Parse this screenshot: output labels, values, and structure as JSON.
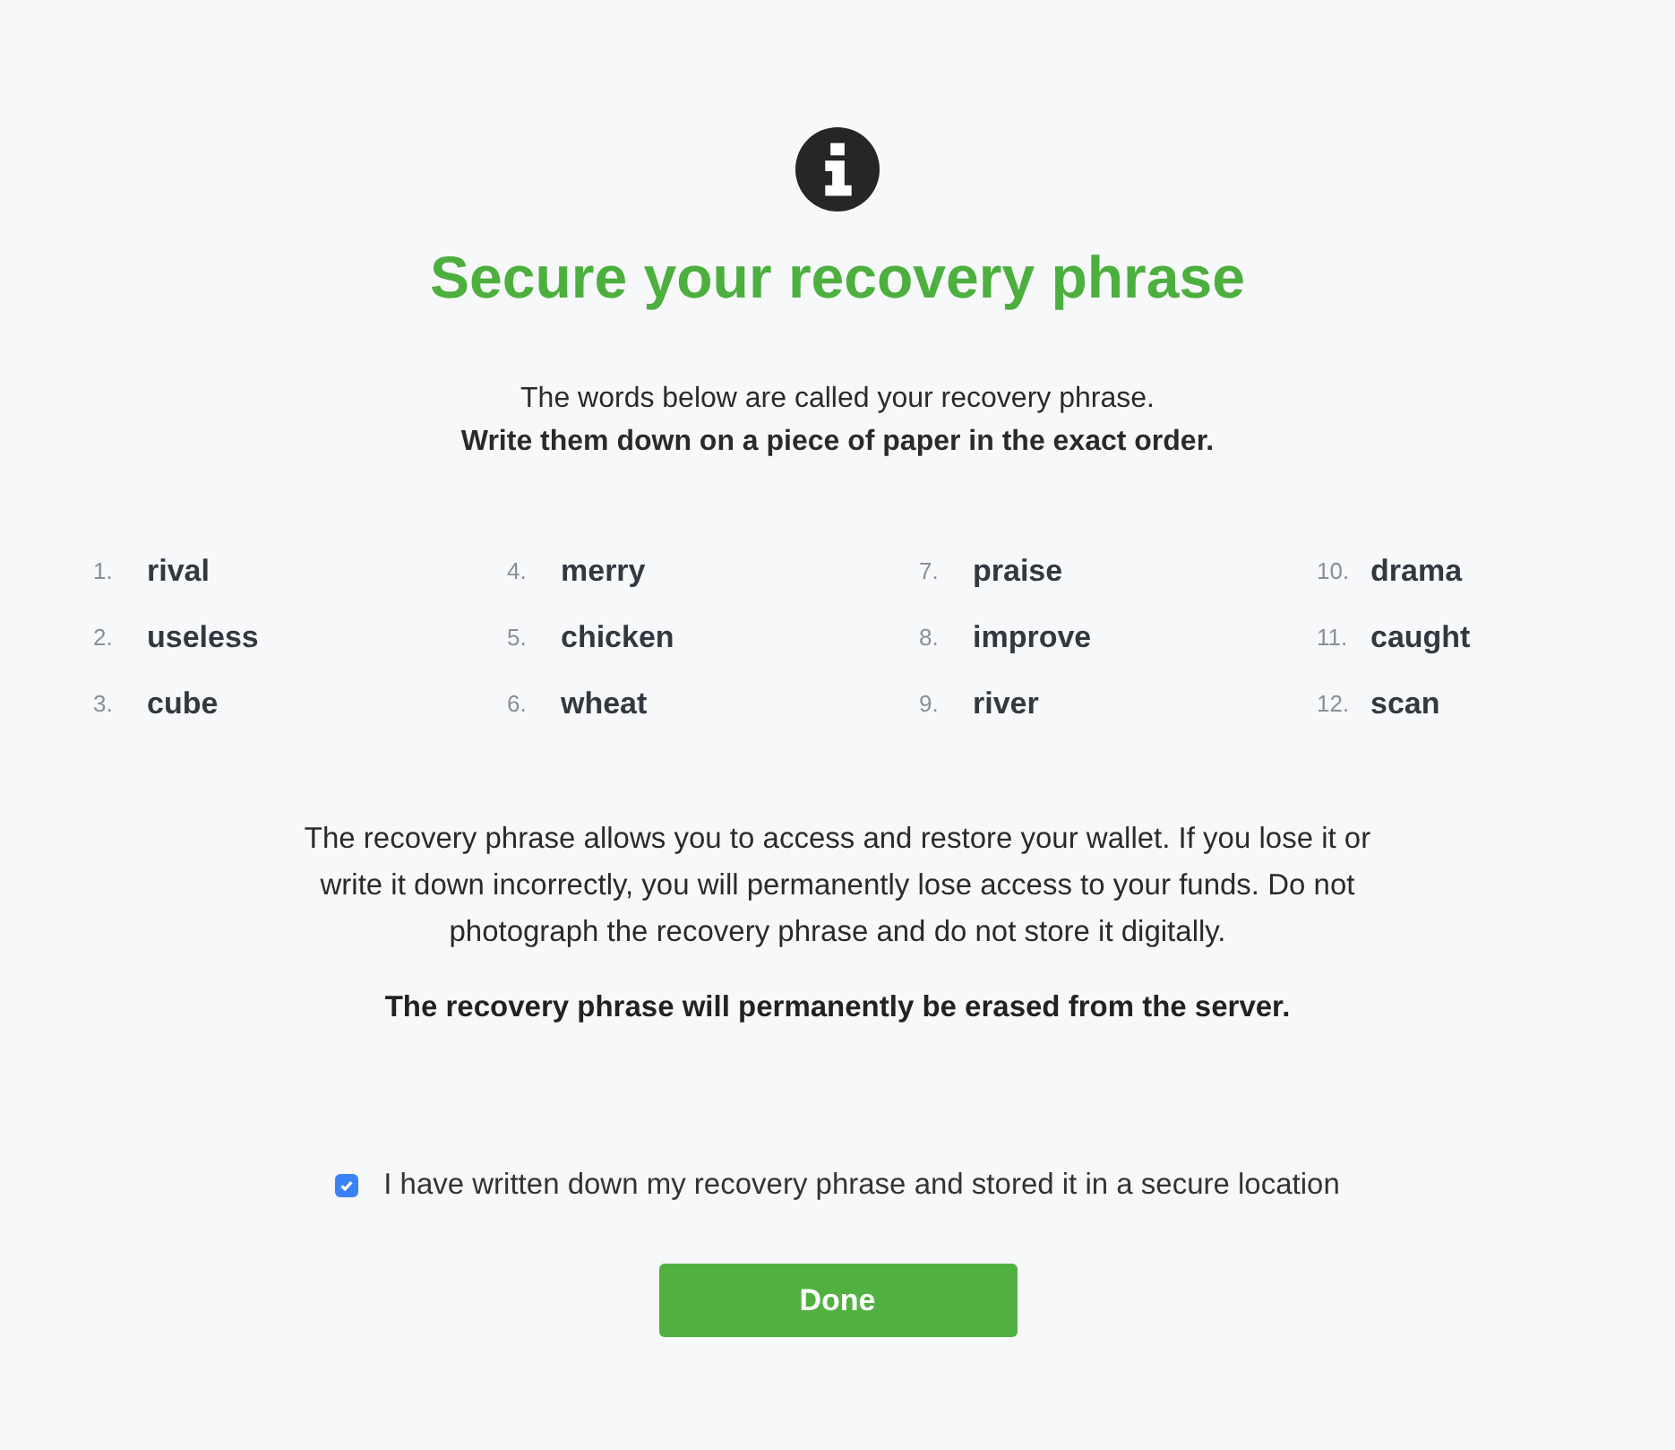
{
  "title": "Secure your recovery phrase",
  "intro": [
    {
      "kind": "plain",
      "text": "The words below are called your recovery phrase."
    },
    {
      "kind": "bold",
      "text": "Write them down on a piece of paper in the exact order."
    }
  ],
  "words": [
    {
      "number": "1.",
      "word": "rival"
    },
    {
      "number": "2.",
      "word": "useless"
    },
    {
      "number": "3.",
      "word": "cube"
    },
    {
      "number": "4.",
      "word": "merry"
    },
    {
      "number": "5.",
      "word": "chicken"
    },
    {
      "number": "6.",
      "word": "wheat"
    },
    {
      "number": "7.",
      "word": "praise"
    },
    {
      "number": "8.",
      "word": "improve"
    },
    {
      "number": "9.",
      "word": "river"
    },
    {
      "number": "10.",
      "word": "drama"
    },
    {
      "number": "11.",
      "word": "caught"
    },
    {
      "number": "12.",
      "word": "scan"
    }
  ],
  "warning": "The recovery phrase allows you to access and restore your wallet. If you lose it or write it down incorrectly, you will permanently lose access to your funds. Do not photograph the recovery phrase and do not store it digitally.",
  "notice": "The recovery phrase will permanently be erased from the server.",
  "confirm": {
    "label": "I have written down my recovery phrase and stored it in a secure location",
    "checked": true
  },
  "button": "Done"
}
